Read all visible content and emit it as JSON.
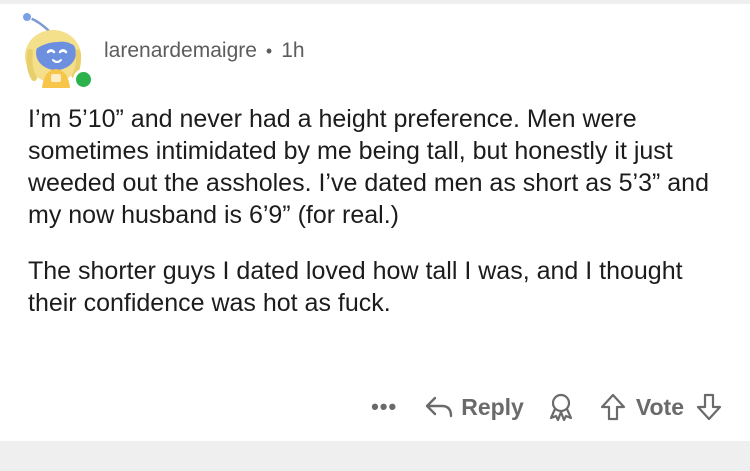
{
  "comment": {
    "username": "larenardemaigre",
    "separator": "•",
    "time": "1h",
    "paragraphs": [
      "I’m 5’10” and never had a height preference. Men were sometimes intimidated by me being tall, but honestly it just weeded out the assholes. I’ve dated men as short as 5’3” and my now husband is 6’9” (for real.)",
      "The shorter guys I dated loved how tall I was, and I thought their confidence was hot as fuck."
    ],
    "online": true
  },
  "actions": {
    "more_label": "•••",
    "reply_label": "Reply",
    "vote_label": "Vote"
  },
  "colors": {
    "online": "#2bb24c",
    "meta_text": "#5c5c5c",
    "action_text": "#6a6a6a",
    "body_text": "#1c1c1c"
  }
}
